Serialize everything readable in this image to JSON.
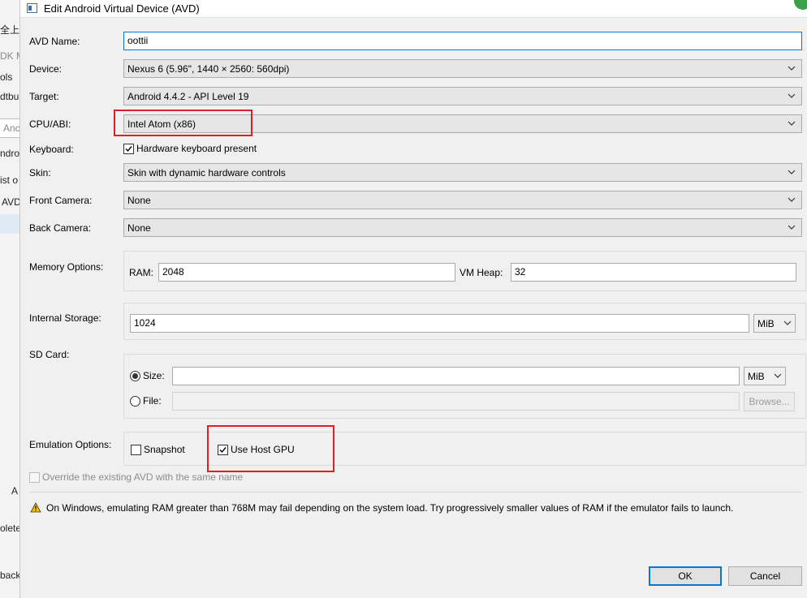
{
  "background_window": {
    "fragments": [
      "全上网",
      "DK M",
      "ols",
      "dtbu",
      "Anc",
      "ndro",
      "ist o",
      "AVD",
      "A",
      "olete",
      "back"
    ]
  },
  "dialog": {
    "title": "Edit Android Virtual Device (AVD)",
    "avd_name": {
      "label": "AVD Name:",
      "value": "oottii"
    },
    "device": {
      "label": "Device:",
      "value": "Nexus 6 (5.96\", 1440 × 2560: 560dpi)"
    },
    "target": {
      "label": "Target:",
      "value": "Android 4.4.2 - API Level 19"
    },
    "cpu_abi": {
      "label": "CPU/ABI:",
      "value": "Intel Atom (x86)"
    },
    "keyboard": {
      "label": "Keyboard:",
      "checkbox_label": "Hardware keyboard present",
      "checked": true
    },
    "skin": {
      "label": "Skin:",
      "value": "Skin with dynamic hardware controls"
    },
    "front_camera": {
      "label": "Front Camera:",
      "value": "None"
    },
    "back_camera": {
      "label": "Back Camera:",
      "value": "None"
    },
    "memory": {
      "label": "Memory Options:",
      "ram_label": "RAM:",
      "ram_value": "2048",
      "vm_heap_label": "VM Heap:",
      "vm_heap_value": "32"
    },
    "internal_storage": {
      "label": "Internal Storage:",
      "value": "1024",
      "unit": "MiB"
    },
    "sd_card": {
      "label": "SD Card:",
      "size_label": "Size:",
      "size_value": "",
      "size_unit": "MiB",
      "size_selected": true,
      "file_label": "File:",
      "file_value": "",
      "browse_label": "Browse..."
    },
    "emulation": {
      "label": "Emulation Options:",
      "snapshot_label": "Snapshot",
      "snapshot_checked": false,
      "host_gpu_label": "Use Host GPU",
      "host_gpu_checked": true
    },
    "override": {
      "label": "Override the existing AVD with the same name",
      "checked": false,
      "enabled": false
    },
    "warning": "On Windows, emulating RAM greater than 768M may fail depending on the system load. Try progressively smaller values of RAM if the emulator fails to launch.",
    "buttons": {
      "ok": "OK",
      "cancel": "Cancel"
    }
  },
  "colors": {
    "highlight": "#e02020",
    "focus": "#0078d7",
    "warning": "#f5c400"
  }
}
